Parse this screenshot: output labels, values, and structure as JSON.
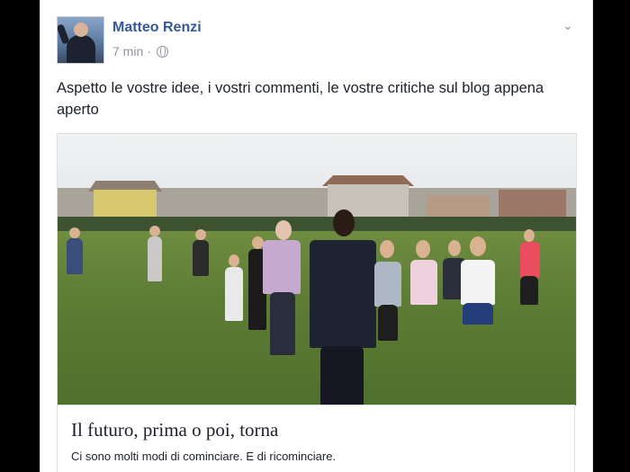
{
  "post": {
    "author": "Matteo Renzi",
    "time": "7 min",
    "separator": "·",
    "audience_icon": "globe-icon",
    "menu_icon": "chevron-down-icon",
    "text": "Aspetto le vostre idee, i vostri commenti, le vostre critiche sul blog appena aperto"
  },
  "link_preview": {
    "title": "Il futuro, prima o poi, torna",
    "description": "Ci sono molti modi di cominciare. E di ricominciare."
  },
  "colors": {
    "author_name": "#365899",
    "meta_text": "#90949c",
    "body_text": "#1d2129",
    "background": "#000000"
  }
}
